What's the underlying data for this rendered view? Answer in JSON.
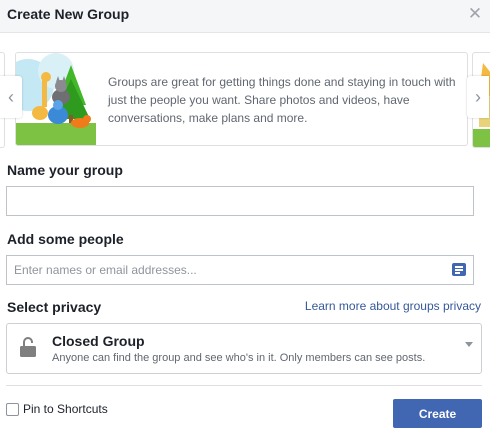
{
  "dialog": {
    "title": "Create New Group",
    "close_icon": "close-icon"
  },
  "carousel": {
    "text": "Groups are great for getting things done and staying in touch with just the people you want. Share photos and videos, have conversations, make plans and more.",
    "prev_icon": "chevron-left-icon",
    "next_icon": "chevron-right-icon"
  },
  "name_section": {
    "label": "Name your group",
    "value": "",
    "placeholder": ""
  },
  "people_section": {
    "label": "Add some people",
    "placeholder": "Enter names or email addresses...",
    "icon": "contact-list-icon"
  },
  "privacy_section": {
    "label": "Select privacy",
    "learn_more": "Learn more about groups privacy",
    "selected_title": "Closed Group",
    "selected_desc": "Anyone can find the group and see who's in it. Only members can see posts.",
    "icon": "lock-icon"
  },
  "footer": {
    "pin_label": "Pin to Shortcuts",
    "pin_checked": false,
    "create_label": "Create"
  },
  "colors": {
    "accent": "#4267b2",
    "link": "#365899",
    "header_bg": "#f5f6f7"
  }
}
